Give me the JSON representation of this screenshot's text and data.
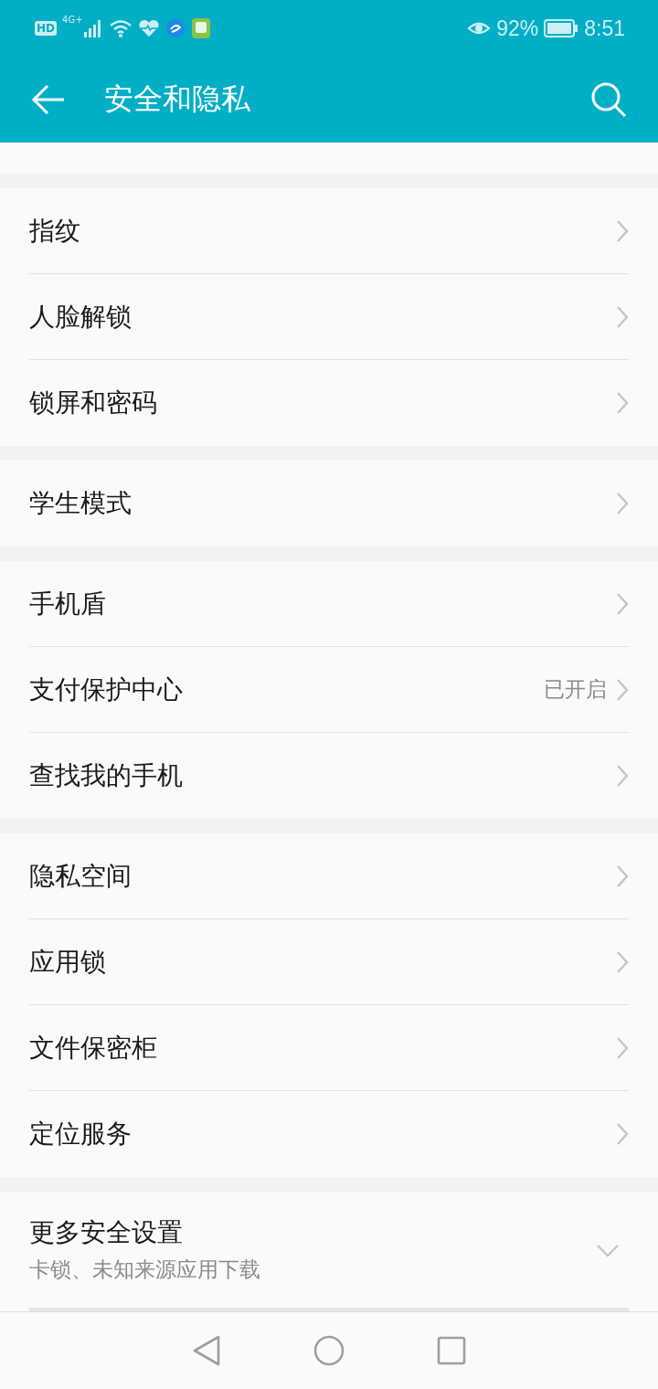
{
  "status_bar": {
    "hd": "HD",
    "network": "4G+",
    "battery_percent": "92%",
    "time": "8:51"
  },
  "header": {
    "title": "安全和隐私"
  },
  "groups": [
    {
      "items": [
        {
          "label": "指纹"
        },
        {
          "label": "人脸解锁"
        },
        {
          "label": "锁屏和密码"
        }
      ]
    },
    {
      "items": [
        {
          "label": "学生模式"
        }
      ]
    },
    {
      "items": [
        {
          "label": "手机盾"
        },
        {
          "label": "支付保护中心",
          "value": "已开启"
        },
        {
          "label": "查找我的手机"
        }
      ]
    },
    {
      "items": [
        {
          "label": "隐私空间"
        },
        {
          "label": "应用锁"
        },
        {
          "label": "文件保密柜"
        },
        {
          "label": "定位服务"
        }
      ]
    }
  ],
  "more_settings": {
    "title": "更多安全设置",
    "subtitle": "卡锁、未知来源应用下载",
    "expanded": false
  }
}
